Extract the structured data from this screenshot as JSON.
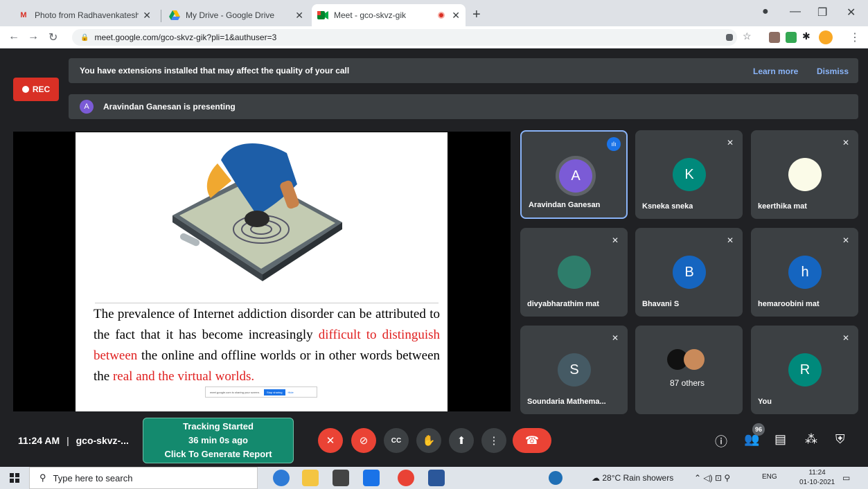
{
  "browser": {
    "tabs": [
      {
        "title": "Photo from Radhavenkatesh - ra",
        "favicon": "gmail-icon",
        "close": "✕"
      },
      {
        "title": "My Drive - Google Drive",
        "favicon": "drive-icon",
        "close": "✕"
      },
      {
        "title": "Meet - gco-skvz-gik",
        "favicon": "meet-icon",
        "close": "✕",
        "active": true
      }
    ],
    "new_tab": "+",
    "url": "meet.google.com/gco-skvz-gik?pli=1&authuser=3"
  },
  "meet": {
    "rec_label": "REC",
    "extension_warning": "You have extensions installed that may affect the quality of your call",
    "learn_more": "Learn more",
    "dismiss": "Dismiss",
    "presenter_initial": "A",
    "presenting_text": "Aravindan Ganesan is presenting",
    "slide": {
      "text_parts": [
        "The prevalence of Internet addiction disorder can be attributed to the fact that it has become increasingly ",
        "difficult to distinguish between",
        " the online and offline worlds or in other words between the ",
        "real and the virtual worlds."
      ],
      "share_notice": "meet.google.com is sharing your screen.",
      "stop_sharing": "Stop sharing",
      "hide": "Hide"
    },
    "participants": [
      {
        "name": "Aravindan Ganesan",
        "initial": "A",
        "color": "#7b5bd6",
        "speaking": true
      },
      {
        "name": "Ksneka sneka",
        "initial": "K",
        "color": "#00897b"
      },
      {
        "name": "keerthika mat",
        "initial": "",
        "color": "#fbfbe8"
      },
      {
        "name": "divyabharathim mat",
        "initial": "",
        "color": "#2e7d6b"
      },
      {
        "name": "Bhavani S",
        "initial": "B",
        "color": "#1565c0"
      },
      {
        "name": "hemaroobini mat",
        "initial": "h",
        "color": "#1565c0"
      },
      {
        "name": "Soundaria Mathema...",
        "initial": "S",
        "color": "#455a64"
      },
      {
        "name": "87 others",
        "initial": "",
        "color": "#3c4043"
      },
      {
        "name": "You",
        "initial": "R",
        "color": "#00897b"
      }
    ],
    "time": "11:24 AM",
    "meeting_code": "gco-skvz-...",
    "tracker": {
      "line1": "Tracking Started",
      "line2": "36 min 0s ago",
      "line3": "Click To Generate Report"
    },
    "people_count": "96"
  },
  "taskbar": {
    "search_placeholder": "Type here to search",
    "weather": "28°C  Rain showers",
    "lang": "ENG",
    "clock_time": "11:24",
    "clock_date": "01-10-2021"
  }
}
